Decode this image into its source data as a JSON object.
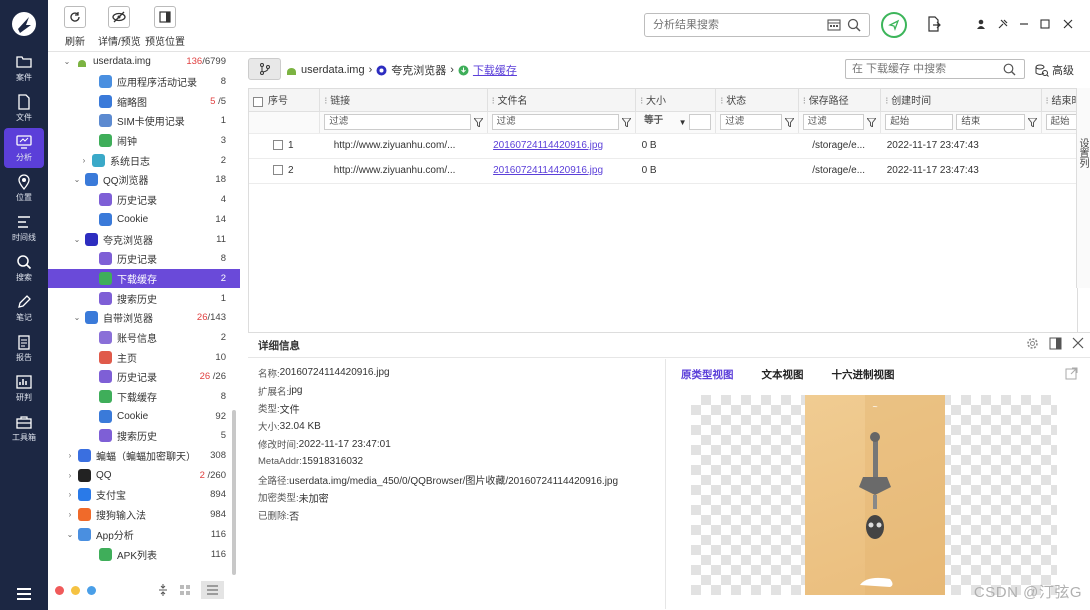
{
  "colors": {
    "nav_bg": "#1c2743",
    "accent": "#5b3fd9",
    "ok": "#3cb55a",
    "red": "#e04040"
  },
  "nav": {
    "items": [
      {
        "label": "案件",
        "icon": "folder-icon"
      },
      {
        "label": "文件",
        "icon": "file-icon"
      },
      {
        "label": "分析",
        "icon": "monitor-icon",
        "active": true
      },
      {
        "label": "位置",
        "icon": "location-icon"
      },
      {
        "label": "时间线",
        "icon": "timeline-icon"
      },
      {
        "label": "搜索",
        "icon": "search-icon"
      },
      {
        "label": "笔记",
        "icon": "pen-icon"
      },
      {
        "label": "报告",
        "icon": "report-icon"
      },
      {
        "label": "研判",
        "icon": "chart-icon"
      },
      {
        "label": "工具箱",
        "icon": "toolbox-icon"
      }
    ]
  },
  "toolbar": {
    "refresh": "刷新",
    "details": "详情/预览",
    "preview_pos": "预览位置",
    "search_placeholder": "分析结果搜索"
  },
  "tree": {
    "root": {
      "label": "userdata.img",
      "count_red": "136",
      "count": "/6799"
    },
    "items": [
      {
        "label": "应用程序活动记录",
        "count": "8",
        "indent": 2,
        "color": "#4a8fe0"
      },
      {
        "label": "缩略图",
        "count_red": "5",
        "count": " /5",
        "indent": 2,
        "color": "#3a7ad9"
      },
      {
        "label": "SIM卡使用记录",
        "count": "1",
        "indent": 2,
        "color": "#5c8ad0"
      },
      {
        "label": "闹钟",
        "count": "3",
        "indent": 2,
        "color": "#3fae5a"
      },
      {
        "label": "系统日志",
        "count": "2",
        "indent": 1.5,
        "color": "#3aa9c8",
        "tw": "›"
      },
      {
        "label": "QQ浏览器",
        "count": "18",
        "indent": 1,
        "color": "#3a7ad9",
        "tw": "⌄"
      },
      {
        "label": "历史记录",
        "count": "4",
        "indent": 2,
        "color": "#7e5fd6"
      },
      {
        "label": "Cookie",
        "count": "14",
        "indent": 2,
        "color": "#3a7ad9"
      },
      {
        "label": "夸克浏览器",
        "count": "11",
        "indent": 1,
        "color": "#2d2dc0",
        "tw": "⌄"
      },
      {
        "label": "历史记录",
        "count": "8",
        "indent": 2,
        "color": "#7e5fd6"
      },
      {
        "label": "下载缓存",
        "count": "2",
        "indent": 2,
        "color": "#3fae5a",
        "sel": true
      },
      {
        "label": "搜索历史",
        "count": "1",
        "indent": 2,
        "color": "#7e5fd6"
      },
      {
        "label": "自带浏览器",
        "count_red": "26",
        "count": "/143",
        "indent": 1,
        "color": "#3a7ad9",
        "tw": "⌄"
      },
      {
        "label": "账号信息",
        "count": "2",
        "indent": 2,
        "color": "#8a6fd8"
      },
      {
        "label": "主页",
        "count": "10",
        "indent": 2,
        "color": "#e05a4a"
      },
      {
        "label": "历史记录",
        "count_red": "26",
        "count": " /26",
        "indent": 2,
        "color": "#7e5fd6"
      },
      {
        "label": "下载缓存",
        "count": "8",
        "indent": 2,
        "color": "#3fae5a"
      },
      {
        "label": "Cookie",
        "count": "92",
        "indent": 2,
        "color": "#3a7ad9"
      },
      {
        "label": "搜索历史",
        "count": "5",
        "indent": 2,
        "color": "#7e5fd6"
      },
      {
        "label": "蝙蝠（蝙蝠加密聊天）",
        "count": "308",
        "indent": 0.5,
        "color": "#3a6fe0",
        "tw": "›"
      },
      {
        "label": "QQ",
        "count_red": "2",
        "count": " /260",
        "indent": 0.5,
        "color": "#222",
        "tw": "›"
      },
      {
        "label": "支付宝",
        "count": "894",
        "indent": 0.5,
        "color": "#2a7ae8",
        "tw": "›"
      },
      {
        "label": "搜狗输入法",
        "count": "984",
        "indent": 0.5,
        "color": "#f06a2a",
        "tw": "›"
      },
      {
        "label": "App分析",
        "count": "116",
        "indent": 0.5,
        "color": "#4a8fe0",
        "tw": "⌄"
      },
      {
        "label": "APK列表",
        "count": "116",
        "indent": 2,
        "color": "#3fae5a"
      }
    ]
  },
  "crumbs": {
    "root": "userdata.img",
    "app": "夸克浏览器",
    "current": "下载缓存"
  },
  "table_search": {
    "placeholder": "在 下载缓存 中搜索",
    "advanced": "高级"
  },
  "table": {
    "headers": [
      "序号",
      "链接",
      "文件名",
      "大小",
      "状态",
      "保存路径",
      "创建时间",
      "结束时间",
      ""
    ],
    "filter": {
      "text": "过滤",
      "size": "等于",
      "start": "起始",
      "end": "结束"
    },
    "rows": [
      {
        "no": "1",
        "url": "http://www.ziyuanhu.com/...",
        "file": "20160724114420916.jpg",
        "size": "0 B",
        "status": "",
        "path": "/storage/e...",
        "ctime": "2022-11-17 23:47:43",
        "etime": "",
        "extra": "u"
      },
      {
        "no": "2",
        "url": "http://www.ziyuanhu.com/...",
        "file": "20160724114420916.jpg",
        "size": "0 B",
        "status": "",
        "path": "/storage/e...",
        "ctime": "2022-11-17 23:47:43",
        "etime": "",
        "extra": "u"
      }
    ],
    "side_tab": "设置列"
  },
  "detail": {
    "title": "详细信息",
    "fields": [
      {
        "label": "名称: ",
        "value": "20160724114420916.jpg"
      },
      {
        "label": "扩展名: ",
        "value": "jpg"
      },
      {
        "label": "类型: ",
        "value": "文件"
      },
      {
        "label": "大小: ",
        "value": "32.04 KB"
      },
      {
        "label": "修改时间: ",
        "value": "2022-11-17 23:47:01"
      },
      {
        "label": "MetaAddr: ",
        "value": "15918316032"
      },
      {
        "label": "全路径: ",
        "value": "userdata.img/media_450/0/QQBrowser/图片收藏/20160724114420916.jpg"
      },
      {
        "label": "加密类型: ",
        "value": "未加密"
      },
      {
        "label": "已删除: ",
        "value": "否"
      }
    ],
    "tabs": [
      "原类型视图",
      "文本视图",
      "十六进制视图"
    ]
  },
  "watermark": "CSDN @汀弦G"
}
